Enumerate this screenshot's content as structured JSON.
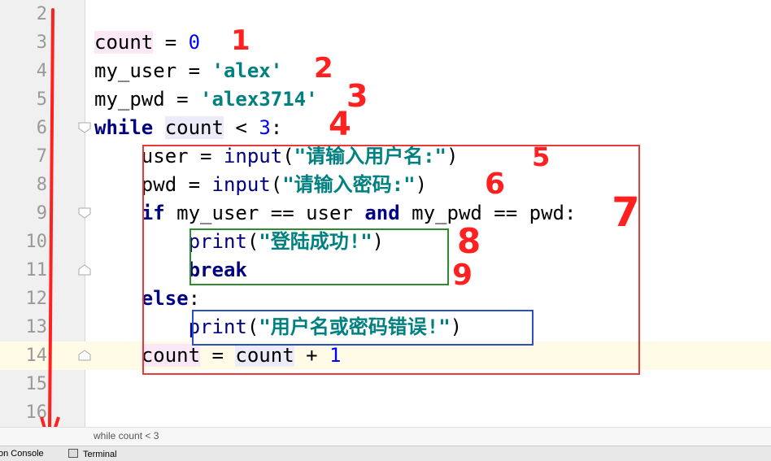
{
  "editor": {
    "lines": [
      {
        "no": "2"
      },
      {
        "no": "3",
        "tokens": [
          {
            "t": "count",
            "c": "var-hl"
          },
          {
            "t": " = "
          },
          {
            "t": "0",
            "c": "num"
          }
        ]
      },
      {
        "no": "4",
        "tokens": [
          {
            "t": "my_user = "
          },
          {
            "t": "'alex'",
            "c": "str"
          }
        ]
      },
      {
        "no": "5",
        "tokens": [
          {
            "t": "my_pwd = "
          },
          {
            "t": "'alex3714'",
            "c": "str"
          }
        ]
      },
      {
        "no": "6",
        "tokens": [
          {
            "t": "while",
            "c": "kw"
          },
          {
            "t": " "
          },
          {
            "t": "count",
            "c": "var-hl2"
          },
          {
            "t": " < "
          },
          {
            "t": "3",
            "c": "num"
          },
          {
            "t": ":"
          }
        ]
      },
      {
        "no": "7",
        "tokens": [
          {
            "t": "    user = "
          },
          {
            "t": "input",
            "c": "fn"
          },
          {
            "t": "("
          },
          {
            "t": "\"请输入用户名:\"",
            "c": "str"
          },
          {
            "t": ")"
          }
        ]
      },
      {
        "no": "8",
        "tokens": [
          {
            "t": "    pwd = "
          },
          {
            "t": "input",
            "c": "fn"
          },
          {
            "t": "("
          },
          {
            "t": "\"请输入密码:\"",
            "c": "str"
          },
          {
            "t": ")"
          }
        ]
      },
      {
        "no": "9",
        "tokens": [
          {
            "t": "    "
          },
          {
            "t": "if",
            "c": "kw"
          },
          {
            "t": " my_user == user "
          },
          {
            "t": "and",
            "c": "kw"
          },
          {
            "t": " my_pwd == pwd:"
          }
        ]
      },
      {
        "no": "10",
        "tokens": [
          {
            "t": "        "
          },
          {
            "t": "print",
            "c": "fn"
          },
          {
            "t": "("
          },
          {
            "t": "\"登陆成功!\"",
            "c": "str"
          },
          {
            "t": ")"
          }
        ]
      },
      {
        "no": "11",
        "tokens": [
          {
            "t": "        "
          },
          {
            "t": "break",
            "c": "kw"
          }
        ]
      },
      {
        "no": "12",
        "tokens": [
          {
            "t": "    "
          },
          {
            "t": "else",
            "c": "kw"
          },
          {
            "t": ":"
          }
        ]
      },
      {
        "no": "13",
        "tokens": [
          {
            "t": "        "
          },
          {
            "t": "print",
            "c": "fn"
          },
          {
            "t": "("
          },
          {
            "t": "\"用户名或密码错误!\"",
            "c": "str"
          },
          {
            "t": ")"
          }
        ]
      },
      {
        "no": "14",
        "current": true,
        "tokens": [
          {
            "t": "    "
          },
          {
            "t": "count",
            "c": "var-hl"
          },
          {
            "t": " = "
          },
          {
            "t": "count",
            "c": "var-hl2"
          },
          {
            "t": " + "
          },
          {
            "t": "1",
            "c": "num"
          }
        ]
      },
      {
        "no": "15"
      },
      {
        "no": "16"
      }
    ]
  },
  "breadcrumb": "while count < 3",
  "tool_windows": {
    "console": "on Console",
    "terminal": "Terminal"
  },
  "annotations": [
    "1",
    "2",
    "3",
    "4",
    "5",
    "6",
    "7",
    "8",
    "9"
  ],
  "colors": {
    "annotation_red": "#ff2020",
    "box_red": "#e83a3a",
    "box_green": "#2e8b2e",
    "box_blue": "#2c4fc7"
  }
}
